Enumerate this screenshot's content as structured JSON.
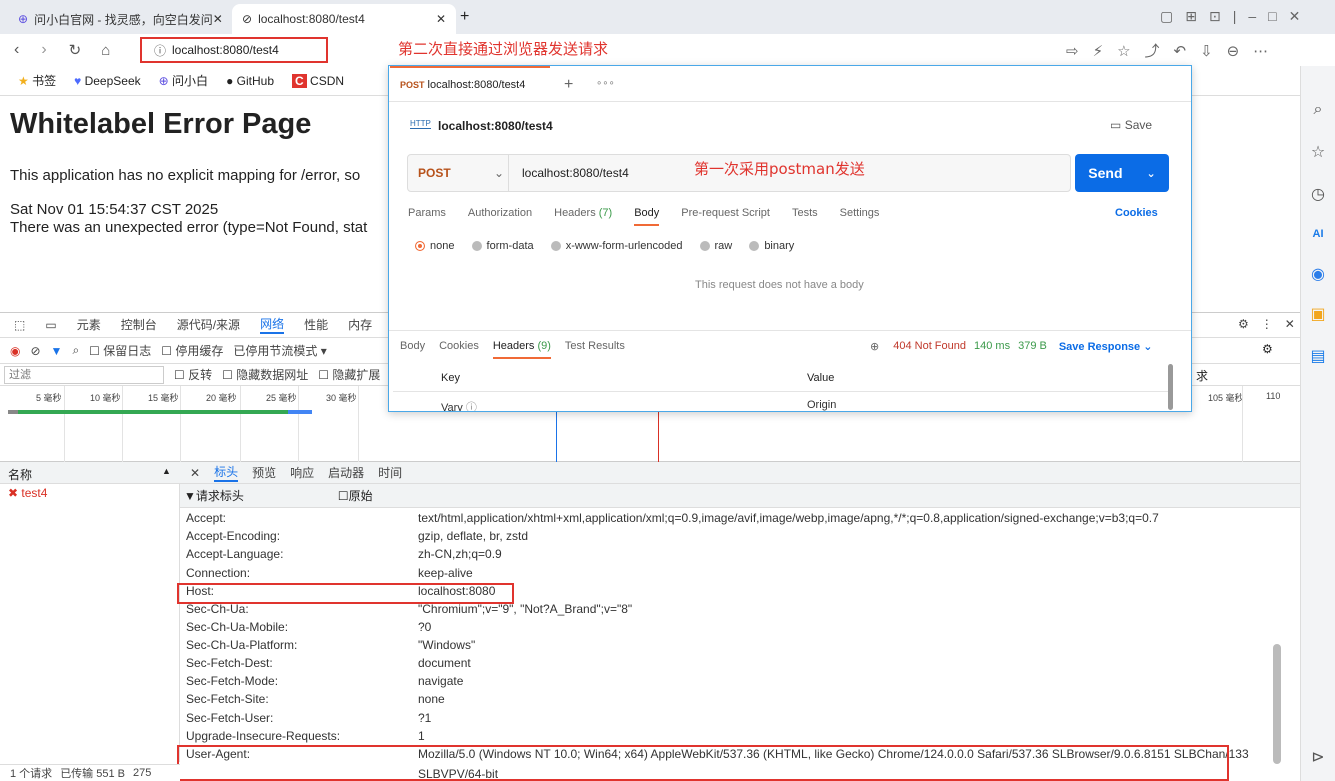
{
  "browser": {
    "tabs": [
      {
        "title": "问小白官网 - 找灵感，向空白发问"
      },
      {
        "title": "localhost:8080/test4"
      }
    ],
    "url": "localhost:8080/test4",
    "annotation_top": "第二次直接通过浏览器发送请求",
    "bookmarks": [
      "书签",
      "DeepSeek",
      "问小白",
      "GitHub",
      "CSDN"
    ]
  },
  "page": {
    "title": "Whitelabel Error Page",
    "line1": "This application has no explicit mapping for /error, so",
    "date": "Sat Nov 01 15:54:37 CST 2025",
    "line2": "There was an unexpected error (type=Not Found, stat"
  },
  "devtools": {
    "tabs": [
      "元素",
      "控制台",
      "源代码/来源",
      "网络",
      "性能",
      "内存"
    ],
    "toolbar": [
      "保留日志",
      "停用缓存",
      "已停用节流模式"
    ],
    "filter_placeholder": "过滤",
    "filters": [
      "反转",
      "隐藏数据网址",
      "隐藏扩展"
    ],
    "right_fragment": "求",
    "ticks": [
      "5 毫秒",
      "10 毫秒",
      "15 毫秒",
      "20 毫秒",
      "25 毫秒",
      "30 毫秒",
      "105 毫秒",
      "110"
    ],
    "list_header": "名称",
    "request_name": "test4",
    "detail_tabs": [
      "标头",
      "预览",
      "响应",
      "启动器",
      "时间"
    ],
    "section": "▼请求标头",
    "raw_label": "原始",
    "headers": [
      {
        "k": "Accept:",
        "v": "text/html,application/xhtml+xml,application/xml;q=0.9,image/avif,image/webp,image/apng,*/*;q=0.8,application/signed-exchange;v=b3;q=0.7"
      },
      {
        "k": "Accept-Encoding:",
        "v": "gzip, deflate, br, zstd"
      },
      {
        "k": "Accept-Language:",
        "v": "zh-CN,zh;q=0.9"
      },
      {
        "k": "Connection:",
        "v": "keep-alive"
      },
      {
        "k": "Host:",
        "v": "localhost:8080"
      },
      {
        "k": "Sec-Ch-Ua:",
        "v": "\"Chromium\";v=\"9\", \"Not?A_Brand\";v=\"8\""
      },
      {
        "k": "Sec-Ch-Ua-Mobile:",
        "v": "?0"
      },
      {
        "k": "Sec-Ch-Ua-Platform:",
        "v": "\"Windows\""
      },
      {
        "k": "Sec-Fetch-Dest:",
        "v": "document"
      },
      {
        "k": "Sec-Fetch-Mode:",
        "v": "navigate"
      },
      {
        "k": "Sec-Fetch-Site:",
        "v": "none"
      },
      {
        "k": "Sec-Fetch-User:",
        "v": "?1"
      },
      {
        "k": "Upgrade-Insecure-Requests:",
        "v": "1"
      },
      {
        "k": "User-Agent:",
        "v": "Mozilla/5.0 (Windows NT 10.0; Win64; x64) AppleWebKit/537.36 (KHTML, like Gecko) Chrome/124.0.0.0 Safari/537.36 SLBrowser/9.0.6.8151 SLBChan/133"
      }
    ],
    "ua_cont": "SLBVPV/64-bit",
    "status": [
      "1 个请求",
      "已传输 551 B",
      "275"
    ]
  },
  "postman": {
    "tab_method": "POST",
    "tab_label": "localhost:8080/test4",
    "title": "localhost:8080/test4",
    "save": "Save",
    "method": "POST",
    "url": "localhost:8080/test4",
    "annotation": "第一次采用postman发送",
    "send": "Send",
    "req_tabs": [
      "Params",
      "Authorization",
      "Headers",
      "Body",
      "Pre-request Script",
      "Tests",
      "Settings"
    ],
    "headers_count": "(7)",
    "cookies": "Cookies",
    "body_options": [
      "none",
      "form-data",
      "x-www-form-urlencoded",
      "raw",
      "binary"
    ],
    "no_body": "This request does not have a body",
    "resp_tabs": [
      "Body",
      "Cookies",
      "Headers",
      "Test Results"
    ],
    "resp_headers_count": "(9)",
    "status": "404 Not Found",
    "time": "140 ms",
    "size": "379 B",
    "save_response": "Save Response",
    "col_key": "Key",
    "col_value": "Value",
    "row_key": "Vary",
    "row_value": "Origin"
  }
}
